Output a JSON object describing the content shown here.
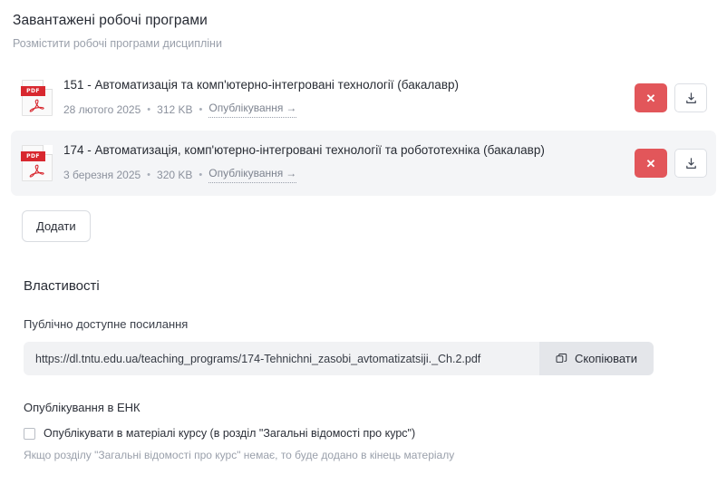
{
  "header": {
    "title": "Завантажені робочі програми",
    "subtitle": "Розмістити робочі програми дисципліни"
  },
  "files": [
    {
      "icon": "pdf-file-icon",
      "icon_label": "PDF",
      "title": "151 - Автоматизація та комп'ютерно-інтегровані технології (бакалавр)",
      "date": "28 лютого 2025",
      "size": "312 KB",
      "publish_link": "Опублікування",
      "publish_arrow": "→",
      "delete_label": "✕",
      "download_icon": "download-icon",
      "highlighted": false
    },
    {
      "icon": "pdf-file-icon",
      "icon_label": "PDF",
      "title": "174 - Автоматизація, комп'ютерно-інтегровані технології та робототехніка (бакалавр)",
      "date": "3 березня 2025",
      "size": "320 KB",
      "publish_link": "Опублікування",
      "publish_arrow": "→",
      "delete_label": "✕",
      "download_icon": "download-icon",
      "highlighted": true
    }
  ],
  "add_button": {
    "label": "Додати"
  },
  "properties": {
    "title": "Властивості",
    "link_label": "Публічно доступне посилання",
    "link_value": "https://dl.tntu.edu.ua/teaching_programs/174-Tehnichni_zasobi_avtomatizatsiji._Ch.2.pdf",
    "link_placeholder": "https://",
    "copy_button": "Скопіювати",
    "copy_icon": "copy-icon"
  },
  "publish_section": {
    "heading": "Опублікування в ЕНК",
    "checkbox_label": "Опублікувати в матеріалі курсу (в розділ \"Загальні відомості про курс\")",
    "checkbox_checked": false,
    "hint": "Якщо розділу \"Загальні відомості про курс\" немає, то буде додано в кінець матеріалу"
  },
  "colors": {
    "danger": "#e2565a",
    "pdf_red": "#d8282f",
    "row_highlight": "#f4f5f7",
    "field_bg": "#f1f2f4",
    "muted_text": "#8b919d"
  },
  "meta_separator": "•"
}
